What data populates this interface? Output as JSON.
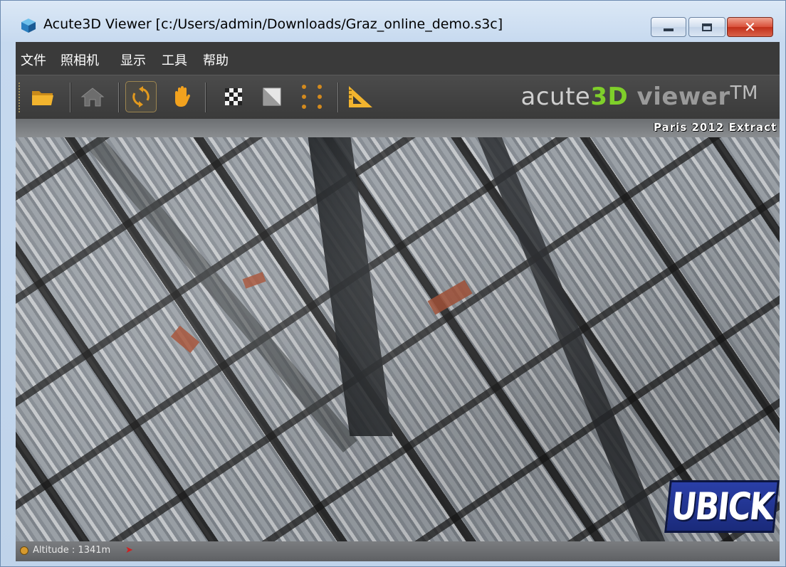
{
  "window": {
    "title": "Acute3D Viewer [c:/Users/admin/Downloads/Graz_online_demo.s3c]",
    "icon": "app-cube-icon",
    "controls": [
      "minimize-icon",
      "maximize-icon",
      "close-icon"
    ],
    "close_glyph": "✕"
  },
  "menu": {
    "items": [
      {
        "label": "文件"
      },
      {
        "label": "照相机"
      },
      {
        "label": "显示"
      },
      {
        "label": "工具"
      },
      {
        "label": "帮助"
      }
    ]
  },
  "toolbar": {
    "buttons": [
      {
        "icon": "folder-open-icon",
        "active": false
      },
      {
        "icon": "home-icon",
        "active": false
      },
      {
        "icon": "orbit-rotate-icon",
        "active": true
      },
      {
        "icon": "pan-hand-icon",
        "active": false
      },
      {
        "icon": "checkerboard-icon",
        "active": false
      },
      {
        "icon": "shading-icon",
        "active": false
      },
      {
        "icon": "points-icon",
        "active": false
      },
      {
        "icon": "measure-ruler-icon",
        "active": false
      }
    ],
    "brand": {
      "prefix": "acute",
      "mid": "3D",
      "suffix": " viewer",
      "tm": "TM"
    },
    "brand_colors": {
      "accent": "#7fcf2a",
      "text": "#cfcfcf"
    }
  },
  "viewport": {
    "scene_title": "Paris 2012 Extract",
    "logo_text": "UBICK",
    "status": {
      "altitude_text": "Altitude : 1341m",
      "arrow": "➤"
    }
  },
  "colors": {
    "titlebar": "#c6d9ef",
    "client_bg": "#3a3a3a",
    "close_button": "#c1301a",
    "logo_blue": "#2a3fa8"
  }
}
